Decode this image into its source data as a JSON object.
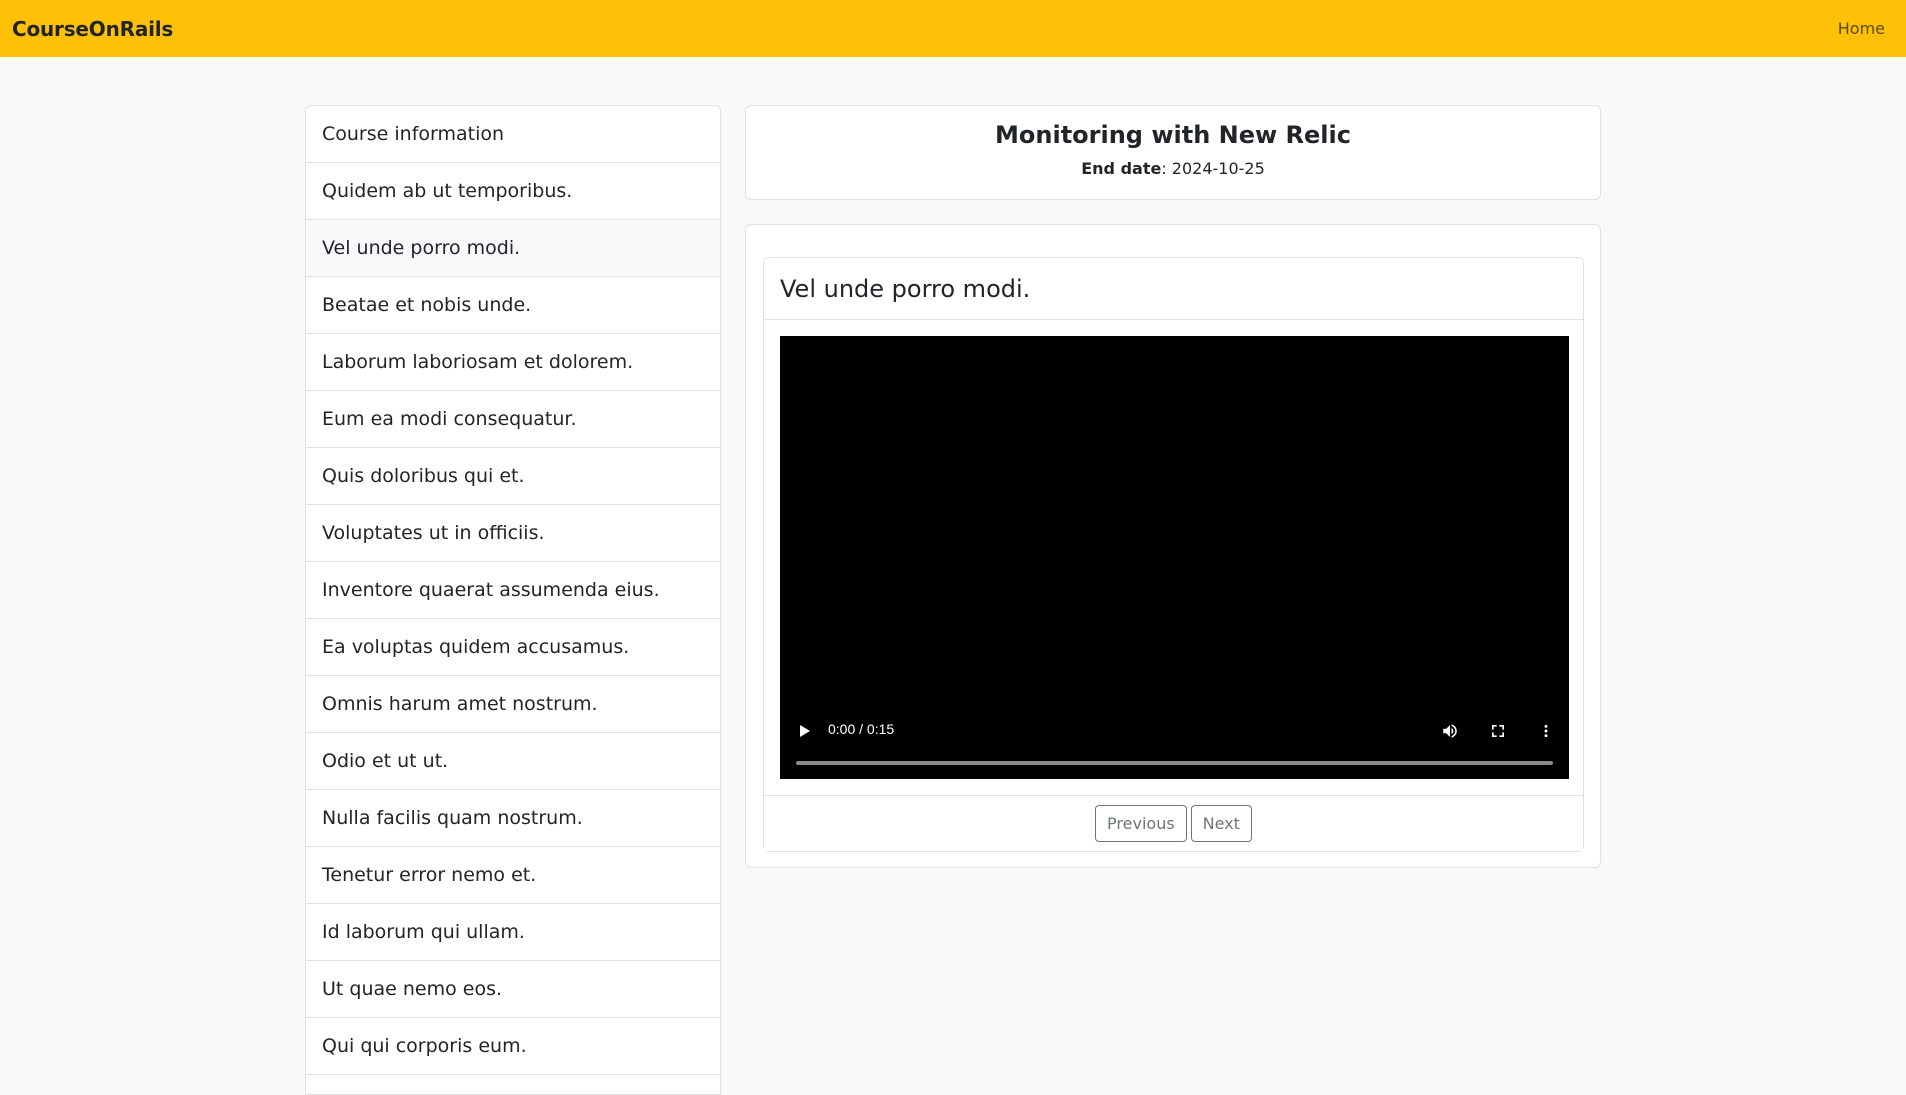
{
  "navbar": {
    "brand": "CourseOnRails",
    "home_label": "Home",
    "background_color": "#ffc107"
  },
  "sidebar": {
    "items": [
      {
        "label": "Course information"
      },
      {
        "label": "Quidem ab ut temporibus."
      },
      {
        "label": "Vel unde porro modi.",
        "active": true
      },
      {
        "label": "Beatae et nobis unde."
      },
      {
        "label": "Laborum laboriosam et dolorem."
      },
      {
        "label": "Eum ea modi consequatur."
      },
      {
        "label": "Quis doloribus qui et."
      },
      {
        "label": "Voluptates ut in officiis."
      },
      {
        "label": "Inventore quaerat assumenda eius."
      },
      {
        "label": "Ea voluptas quidem accusamus."
      },
      {
        "label": "Omnis harum amet nostrum."
      },
      {
        "label": "Odio et ut ut."
      },
      {
        "label": "Nulla facilis quam nostrum."
      },
      {
        "label": "Tenetur error nemo et."
      },
      {
        "label": "Id laborum qui ullam."
      },
      {
        "label": "Ut quae nemo eos."
      },
      {
        "label": "Qui qui corporis eum."
      }
    ]
  },
  "course": {
    "title": "Monitoring with New Relic",
    "end_date_label": "End date",
    "end_date_value": "2024-10-25"
  },
  "lesson": {
    "title": "Vel unde porro modi.",
    "video": {
      "time_display": "0:00 / 0:15",
      "progress": 0
    },
    "prev_label": "Previous",
    "next_label": "Next"
  }
}
